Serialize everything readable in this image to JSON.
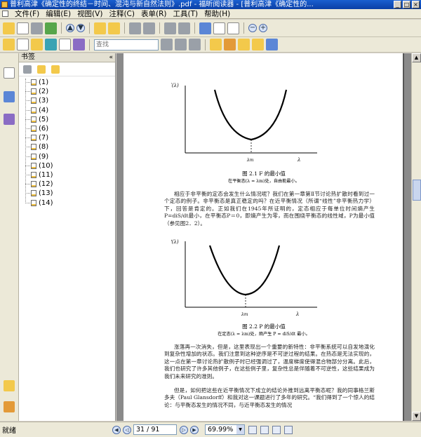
{
  "window": {
    "title": "普利高津《确定性的终结－时间、混沌与新自然法则》.pdf - 福昕阅读器 - [普利高津《确定性的..."
  },
  "menu": {
    "items": [
      "文件(F)",
      "编辑(E)",
      "视图(V)",
      "注释(C)",
      "表单(R)",
      "工具(T)",
      "帮助(H)"
    ]
  },
  "toolbar": {
    "search_placeholder": "查找"
  },
  "sidebar": {
    "header": "书签",
    "collapse_label": "«",
    "bookmarks": [
      "(1)",
      "(2)",
      "(3)",
      "(4)",
      "(5)",
      "(6)",
      "(7)",
      "(8)",
      "(9)",
      "(10)",
      "(11)",
      "(12)",
      "(13)",
      "(14)"
    ]
  },
  "page": {
    "fig1": {
      "ylabel": "F(λ)",
      "xlabel": "λ",
      "min_label": "λm",
      "caption": "图 2.1   F 的最小值",
      "subcaption": "在平衡态(λ = λm)处，自由能最小。"
    },
    "para1": "相应于非平衡的定态会发生什么情况呢？我们在第一章第Ⅱ节讨论热扩散时看到过一个定态的例子。非平衡态是真正稳定的吗？在近平衡情况（所谓“线性”非平衡热力学）下，回答是肯定的。正如我们在1945年所证明的，定态相应于每单位时间熵产生P=diS/dt最小，在平衡态P＝0，即熵产生为零，而在围绕平衡态的线性域，P为最小值（参见图2．2）。",
    "fig2": {
      "ylabel": "P(λ)",
      "xlabel": "λ",
      "min_label": "λm",
      "caption": "图 2.2   P 的最小值",
      "subcaption": "在定态(λ = λm)处，熵产生 P = diS/dt 最小。"
    },
    "para2": "涨落再一次消失，但是，这里表现出一个重要的新特性：非平衡系统可以自发地演化到复杂性增加的状态。我们注意到这种逆序是不可逆过程的结果。在热态是无法实现的，这一点在第一章讨论热扩散例子时已经强调过了，温度梯度使得混合物部分分离。此后，我们也研究了许多其他例子，在这些例子里，复杂性总是伴随着不可逆性，这些结果成为我们未来研究的准则。",
    "para3": "但是，如何把这些在近平衡情况下成立的结论外推到远离平衡态呢？我的同事格兰斯多夫（Paul Glansdorff）和我对这一课题进行了多年的研究。“我们得到了一个惊人的结论：与平衡态发生的情况不同，与近平衡态发生的情况"
  },
  "status": {
    "text": "就绪",
    "page_indicator": "31 / 91",
    "zoom": "69.99%"
  }
}
